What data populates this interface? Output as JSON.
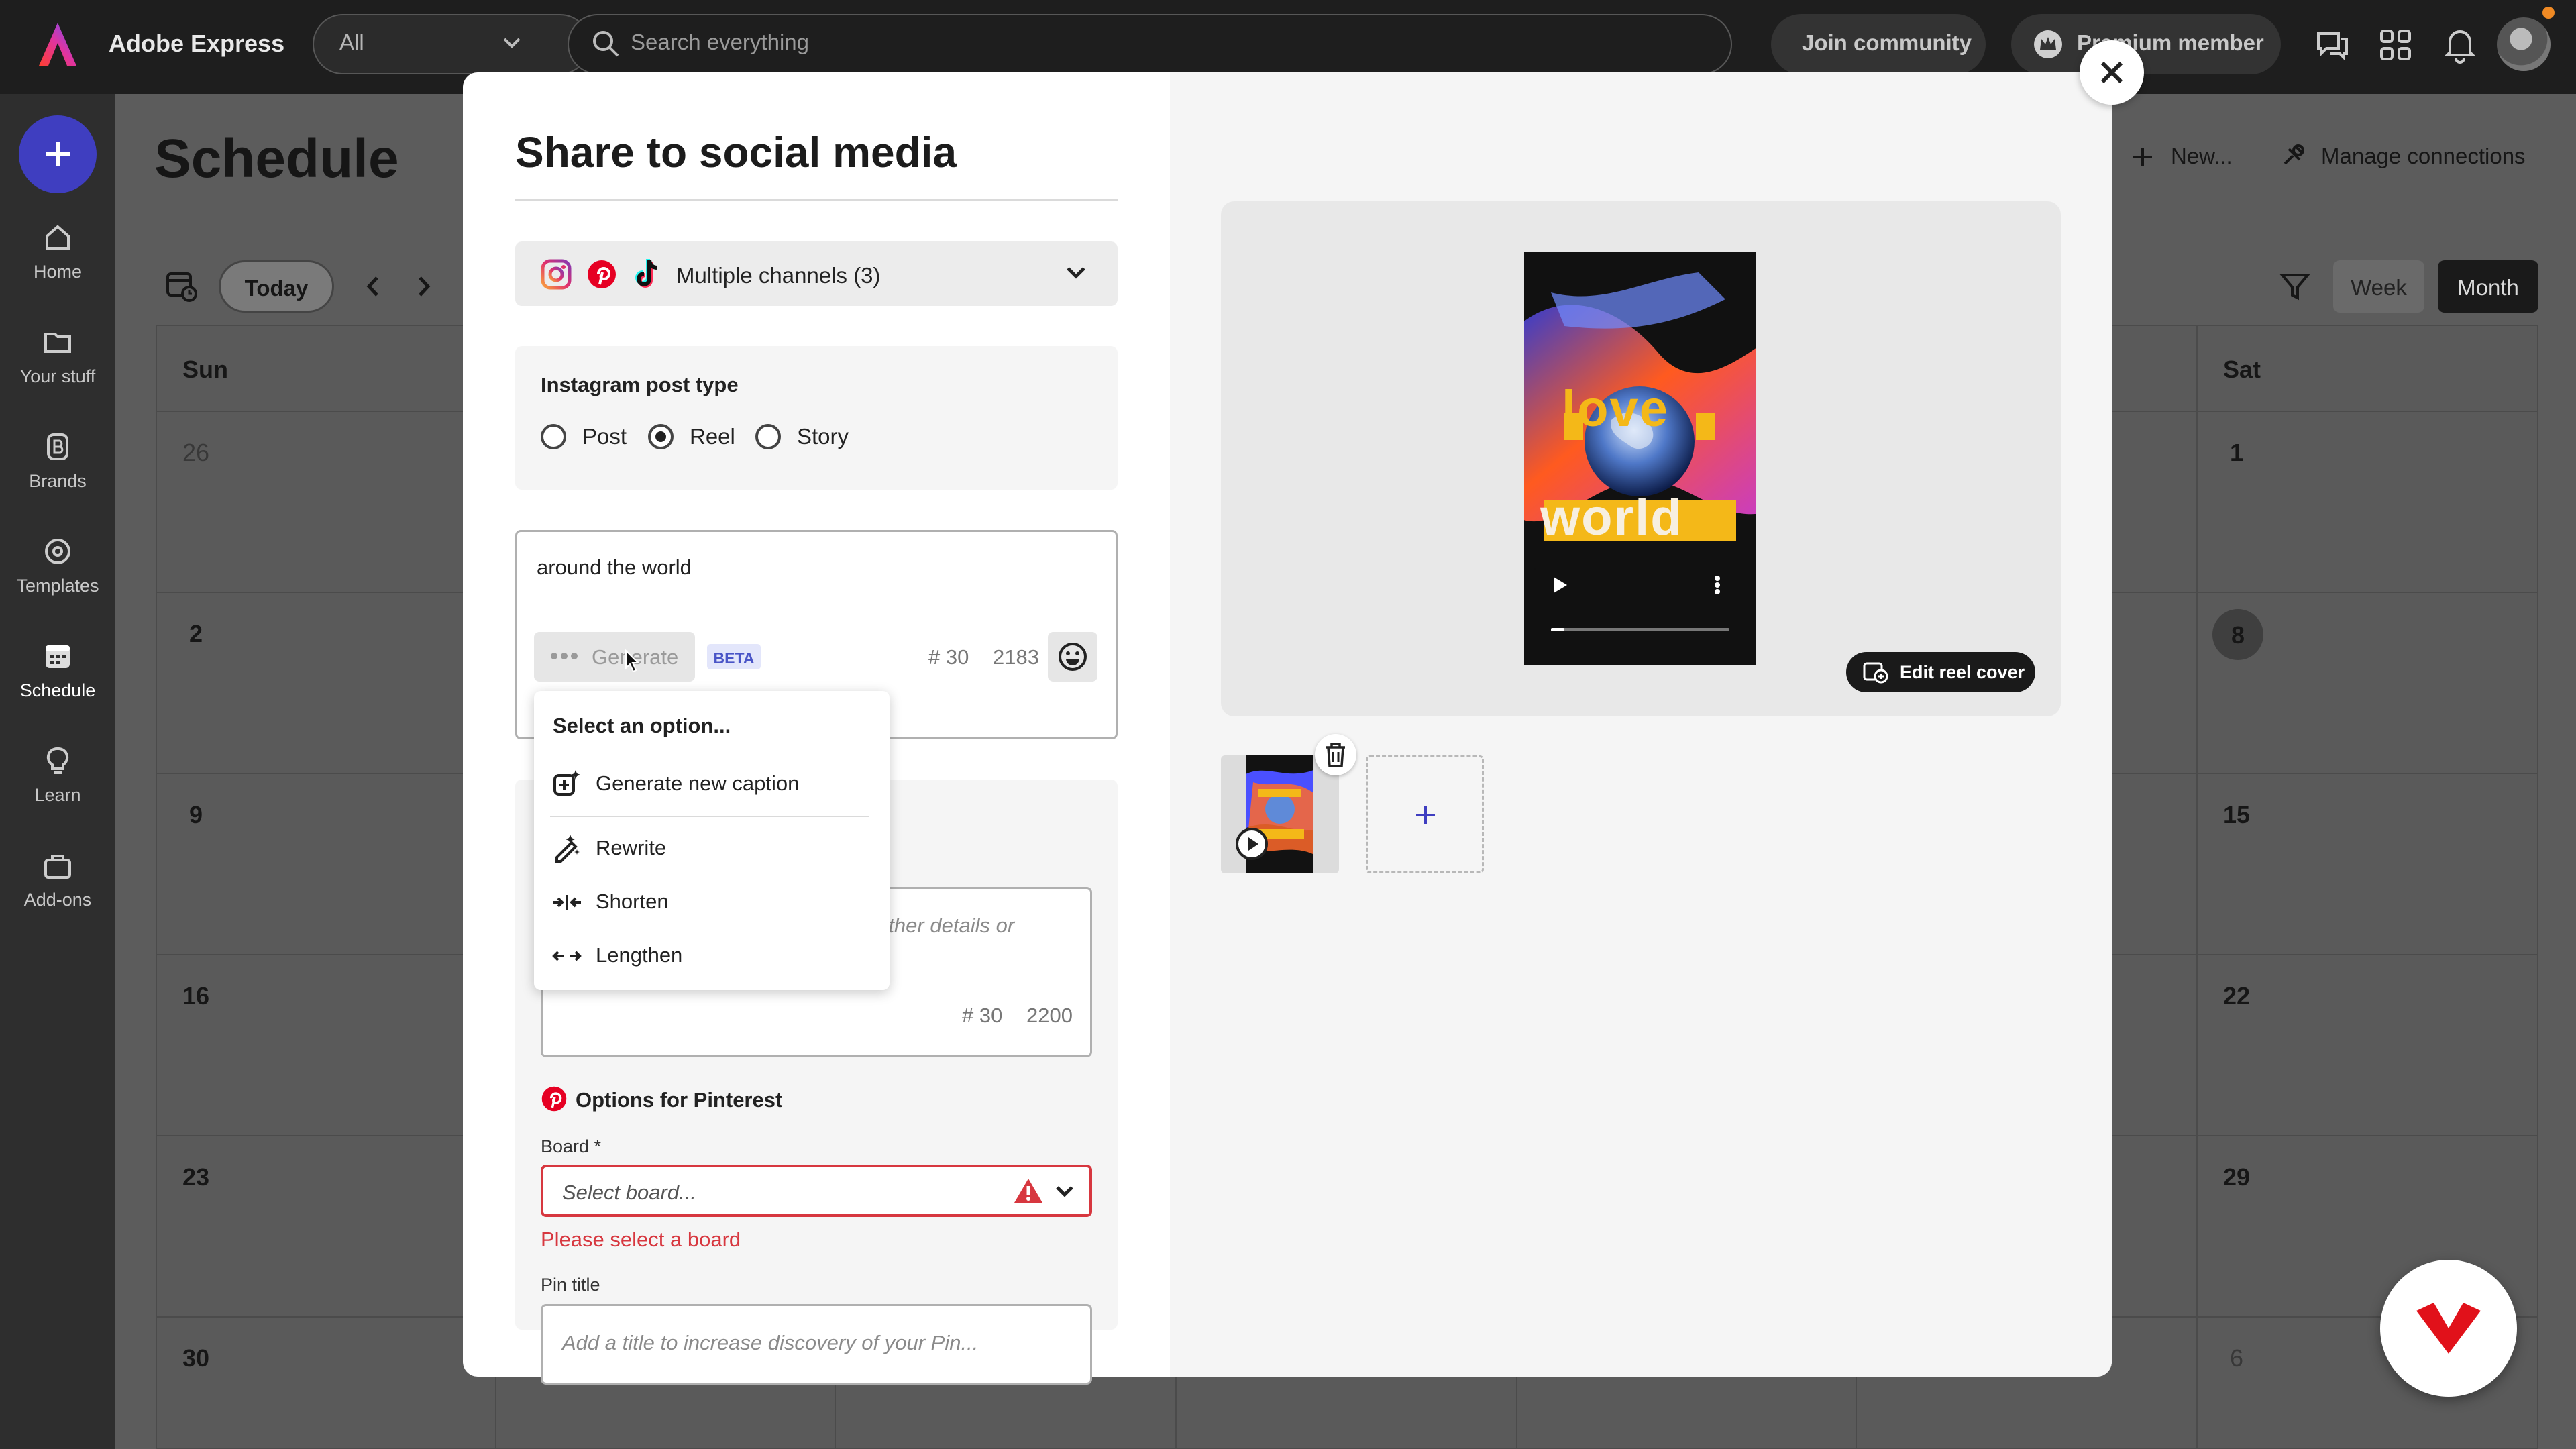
{
  "app": {
    "name": "Adobe Express"
  },
  "topbar": {
    "scope": "All",
    "search_placeholder": "Search everything",
    "join_community": "Join community",
    "premium": "Premium member"
  },
  "rail": {
    "items": [
      "Home",
      "Your stuff",
      "Brands",
      "Templates",
      "Schedule",
      "Learn",
      "Add-ons"
    ]
  },
  "schedule": {
    "title": "Schedule",
    "today": "Today",
    "new": "New...",
    "manage": "Manage connections",
    "week": "Week",
    "month": "Month",
    "day_headers": {
      "sun": "Sun",
      "sat": "Sat"
    },
    "sun_dates": [
      "26",
      "2",
      "9",
      "16",
      "23",
      "30"
    ],
    "sat_dates": [
      "1",
      "8",
      "15",
      "22",
      "29",
      "6"
    ]
  },
  "modal": {
    "title": "Share to social media",
    "channels_label": "Multiple channels (3)",
    "post_type_title": "Instagram post type",
    "post_types": [
      "Post",
      "Reel",
      "Story"
    ],
    "selected_post_type": "Reel",
    "caption": "around the world",
    "generate": "Generate",
    "beta": "BETA",
    "caption_hashtags": "# 30",
    "caption_chars": "2183",
    "menu": {
      "title": "Select an option...",
      "items": [
        "Generate new caption",
        "Rewrite",
        "Shorten",
        "Lengthen"
      ]
    },
    "description_placeholder": "rther details or",
    "desc_hashtags": "# 30",
    "desc_chars": "2200",
    "pinterest_title": "Options for Pinterest",
    "board_label": "Board *",
    "board_placeholder": "Select board...",
    "board_error": "Please select a board",
    "pin_title_label": "Pin title",
    "pin_title_placeholder": "Add a title to increase discovery of your Pin...",
    "edit_cover": "Edit reel cover",
    "poster_words": {
      "top": "love",
      "bottom": "world"
    }
  },
  "colors": {
    "accent": "#3f3ec0",
    "error": "#d7373f",
    "topbar": "#1e1e1e"
  }
}
